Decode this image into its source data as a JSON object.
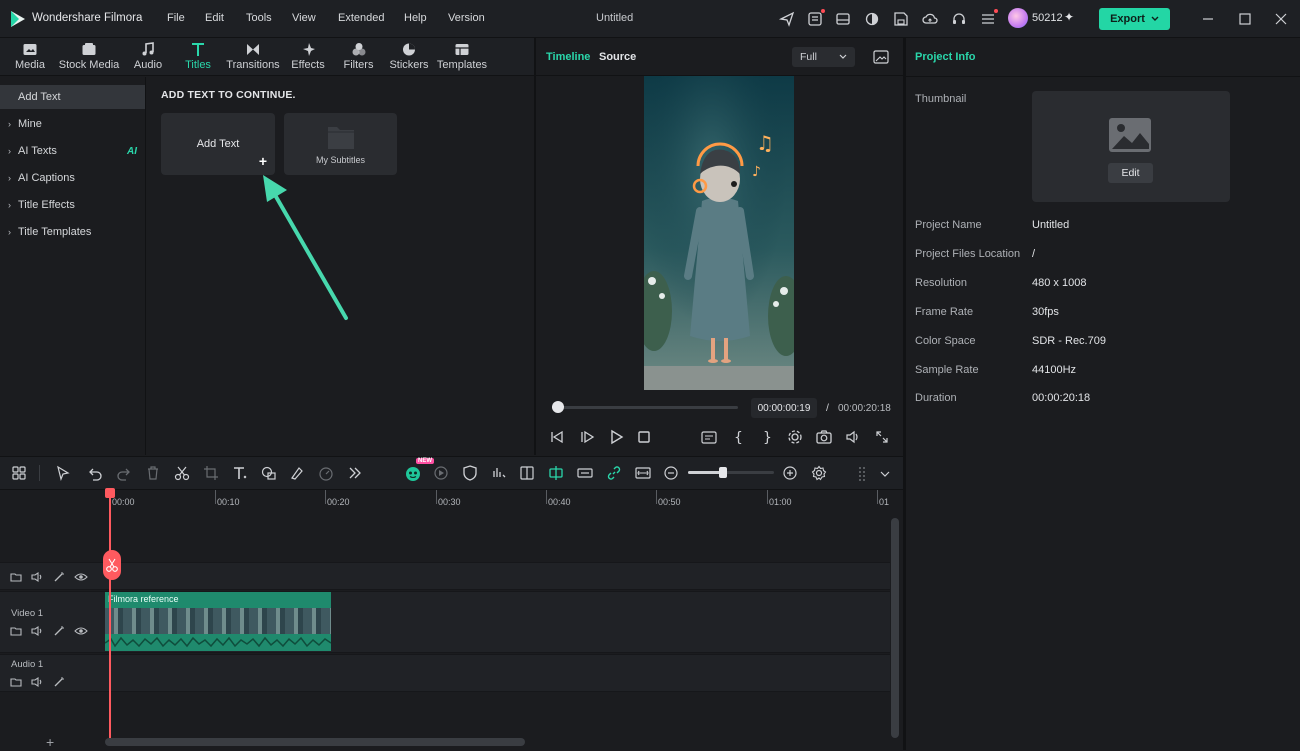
{
  "app": {
    "name": "Wondershare Filmora",
    "menu": [
      "File",
      "Edit",
      "Tools",
      "View",
      "Extended",
      "Help",
      "Version"
    ],
    "project_title": "Untitled",
    "credits": "50212",
    "export_label": "Export",
    "accent": "#23d6a5"
  },
  "media_tabs": [
    "Media",
    "Stock Media",
    "Audio",
    "Titles",
    "Transitions",
    "Effects",
    "Filters",
    "Stickers",
    "Templates"
  ],
  "active_media_tab": "Titles",
  "left_nav": [
    {
      "label": "Add Text"
    },
    {
      "label": "Mine"
    },
    {
      "label": "AI Texts",
      "badge": "AI"
    },
    {
      "label": "AI Captions"
    },
    {
      "label": "Title Effects"
    },
    {
      "label": "Title Templates"
    }
  ],
  "content": {
    "heading": "ADD TEXT TO CONTINUE.",
    "cards": [
      {
        "label": "Add Text"
      },
      {
        "label": "My Subtitles"
      }
    ]
  },
  "player": {
    "tabs": [
      "Timeline",
      "Source"
    ],
    "quality": "Full",
    "current_time": "00:00:00:19",
    "separator": "/",
    "total_time": "00:00:20:18",
    "progress": 0.02
  },
  "project_info": {
    "title": "Project Info",
    "thumbnail_label": "Thumbnail",
    "edit_label": "Edit",
    "rows": [
      {
        "label": "Project Name",
        "value": "Untitled"
      },
      {
        "label": "Project Files Location",
        "value": "/"
      },
      {
        "label": "Resolution",
        "value": "480 x 1008"
      },
      {
        "label": "Frame Rate",
        "value": "30fps"
      },
      {
        "label": "Color Space",
        "value": "SDR - Rec.709"
      },
      {
        "label": "Sample Rate",
        "value": "44100Hz"
      },
      {
        "label": "Duration",
        "value": "00:00:20:18"
      }
    ]
  },
  "timeline": {
    "ruler": [
      "00:00",
      "00:10",
      "00:20",
      "00:30",
      "00:40",
      "00:50",
      "01:00",
      "01"
    ],
    "tracks": {
      "video": "Video 1",
      "audio": "Audio 1"
    },
    "clip_title": "Filmora reference",
    "new_badge": "NEW",
    "zoom_level": 0.4
  }
}
